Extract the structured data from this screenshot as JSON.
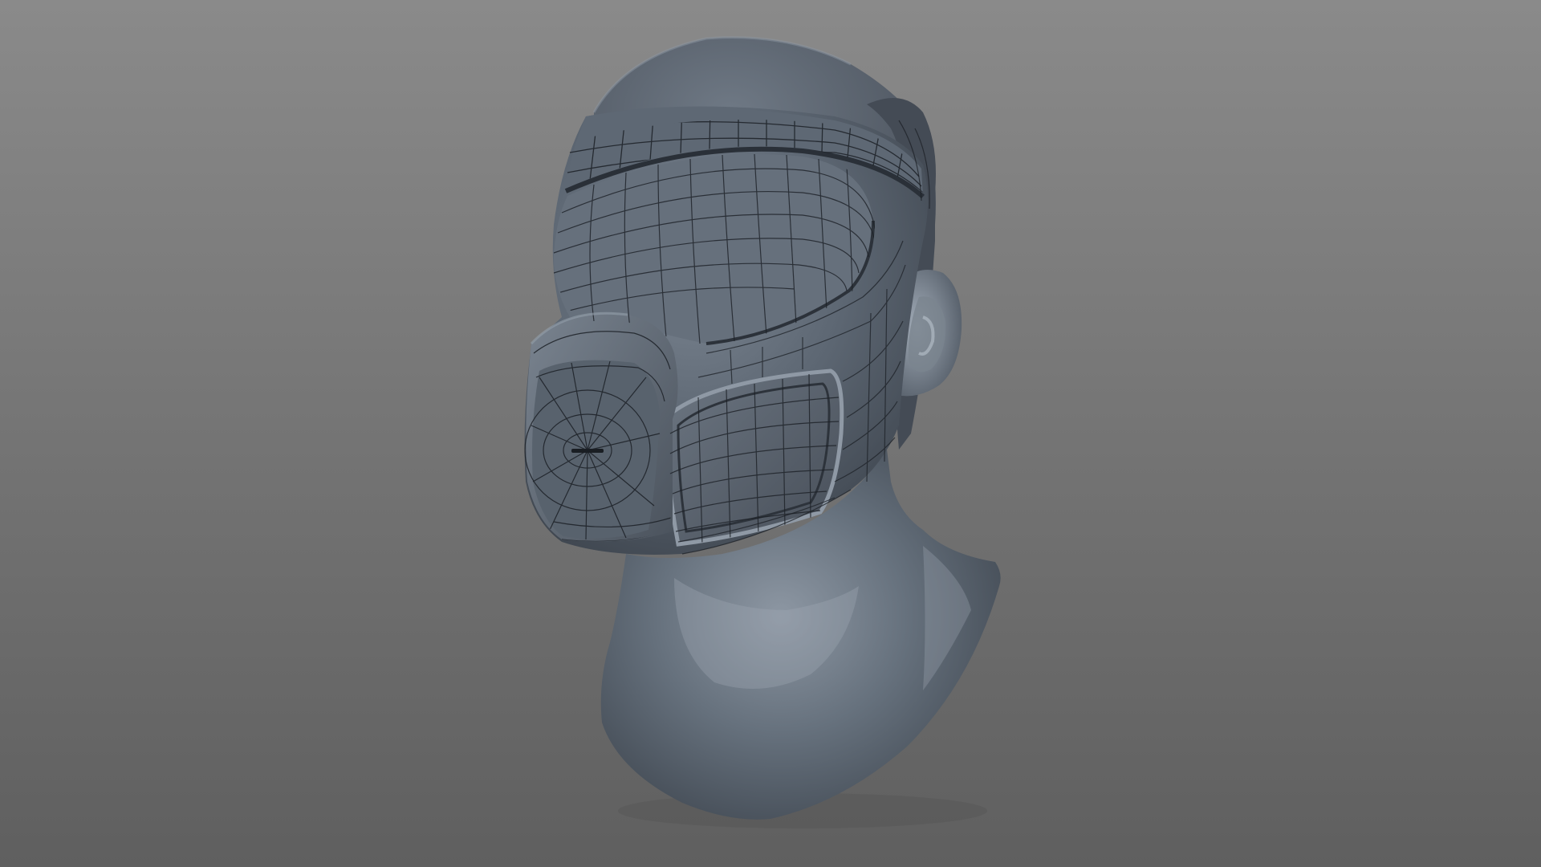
{
  "scene": {
    "background_top": "#8a8a8a",
    "background_bottom": "#5f5f5f",
    "model_base_color": "#5a6470",
    "model_highlight_color": "#8d97a3",
    "model_shadow_color": "#343a42",
    "wireframe_color": "#1c2026"
  }
}
